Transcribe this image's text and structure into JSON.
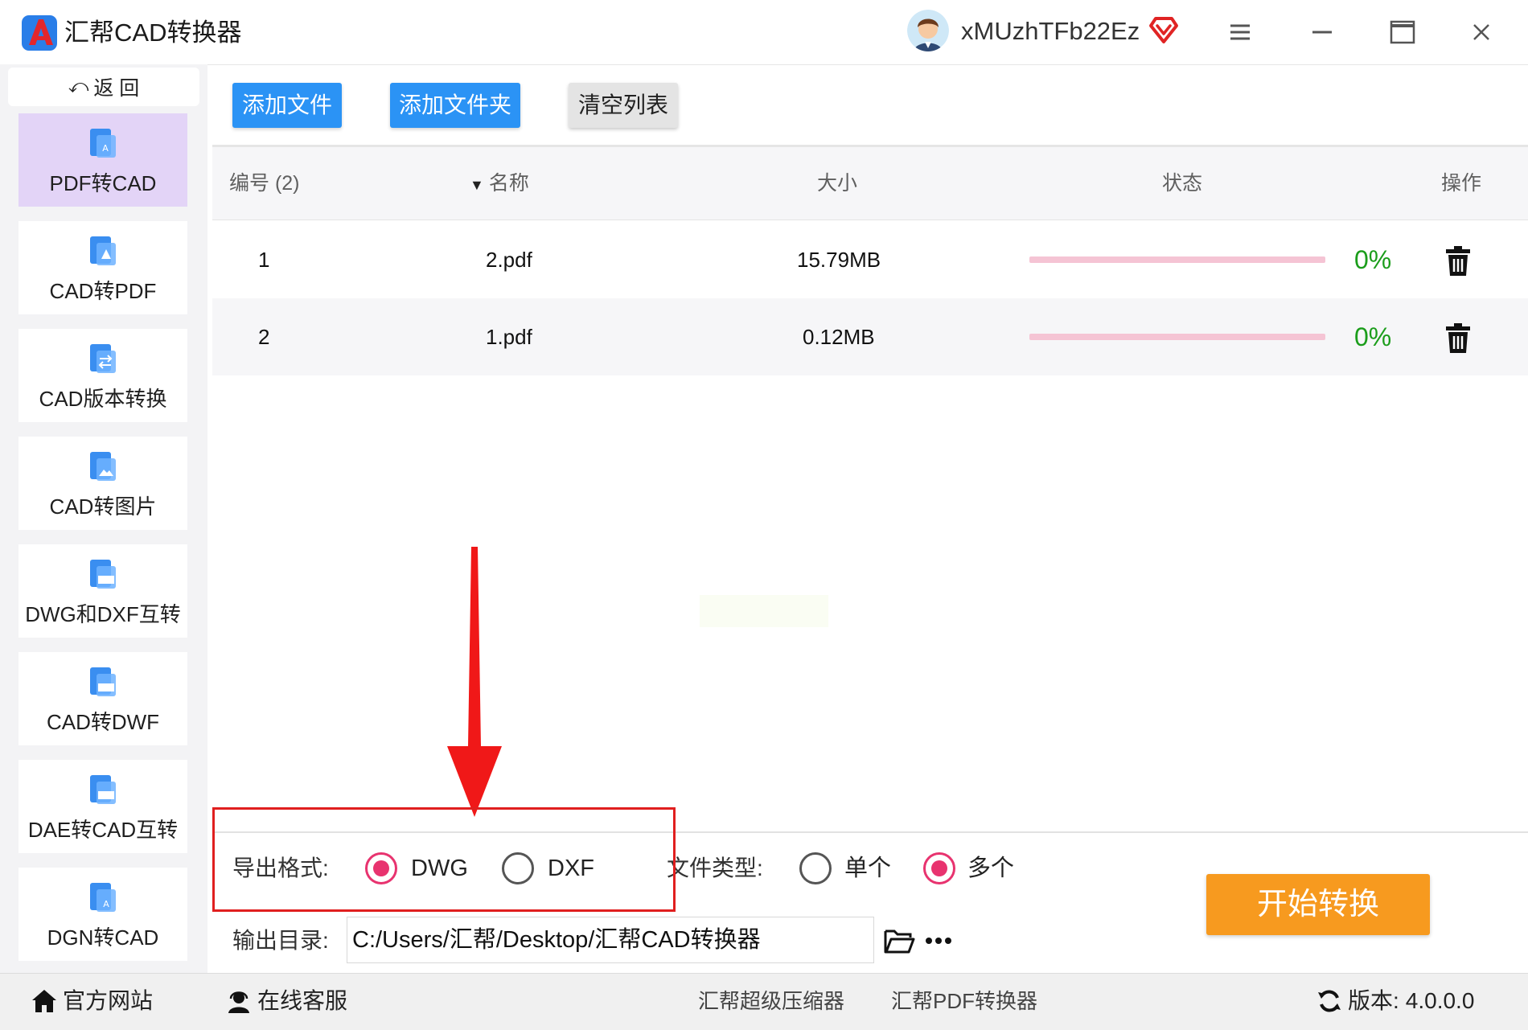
{
  "app": {
    "title": "汇帮CAD转换器"
  },
  "user": {
    "name": "xMUzhTFb22Ez"
  },
  "sidebar": {
    "back_label": "返 回",
    "items": [
      {
        "label": "PDF转CAD",
        "active": true
      },
      {
        "label": "CAD转PDF"
      },
      {
        "label": "CAD版本转换"
      },
      {
        "label": "CAD转图片"
      },
      {
        "label": "DWG和DXF互转"
      },
      {
        "label": "CAD转DWF"
      },
      {
        "label": "DAE转CAD互转"
      },
      {
        "label": "DGN转CAD"
      }
    ]
  },
  "toolbar": {
    "add_file": "添加文件",
    "add_folder": "添加文件夹",
    "clear_list": "清空列表"
  },
  "table": {
    "headers": {
      "number": "编号 (2)",
      "name": "名称",
      "size": "大小",
      "status": "状态",
      "action": "操作"
    },
    "rows": [
      {
        "number": "1",
        "name": "2.pdf",
        "size": "15.79MB",
        "progress": 0,
        "percent": "0%"
      },
      {
        "number": "2",
        "name": "1.pdf",
        "size": "0.12MB",
        "progress": 0,
        "percent": "0%"
      }
    ]
  },
  "settings": {
    "export_format_label": "导出格式:",
    "formats": [
      {
        "label": "DWG",
        "selected": true
      },
      {
        "label": "DXF",
        "selected": false
      }
    ],
    "file_type_label": "文件类型:",
    "file_types": [
      {
        "label": "单个",
        "selected": false
      },
      {
        "label": "多个",
        "selected": true
      }
    ],
    "output_dir_label": "输出目录:",
    "output_dir_value": "C:/Users/汇帮/Desktop/汇帮CAD转换器"
  },
  "start_button": "开始转换",
  "statusbar": {
    "website": "官方网站",
    "support": "在线客服",
    "link1": "汇帮超级压缩器",
    "link2": "汇帮PDF转换器",
    "version_label": "版本:",
    "version": "4.0.0.0"
  },
  "colors": {
    "primary_blue": "#2b93f5",
    "start_orange": "#f79a1f",
    "radio_pink": "#e8336f",
    "progress_pink": "#f5c4d4",
    "percent_green": "#1b9d1b",
    "annotation_red": "#e01f1f",
    "active_nav": "#e3d4f7"
  }
}
